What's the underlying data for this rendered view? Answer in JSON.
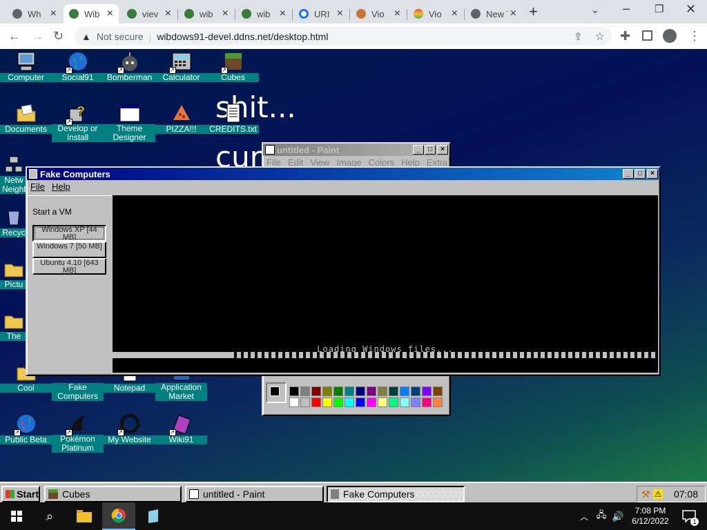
{
  "browser": {
    "tabs": [
      {
        "label": "Wh",
        "fav": "#4285f4"
      },
      {
        "label": "Wib",
        "fav": "#3a7a3a"
      },
      {
        "label": "viev",
        "fav": "#3a7a3a"
      },
      {
        "label": "wib",
        "fav": "#3a7a3a"
      },
      {
        "label": "wib",
        "fav": "#3a7a3a"
      },
      {
        "label": "URI",
        "fav": "#1a73e8"
      },
      {
        "label": "Vio",
        "fav": "#c87533"
      },
      {
        "label": "Vio",
        "fav": "#e8a33d"
      },
      {
        "label": "New Tab",
        "fav": "#5f6368"
      }
    ],
    "security_label": "Not secure",
    "url": "wibdows91-devel.ddns.net/desktop.html"
  },
  "desktop": {
    "icons": [
      {
        "label": "Computer",
        "icon": "computer-icon"
      },
      {
        "label": "Social91",
        "icon": "globe-icon"
      },
      {
        "label": "Bomberman",
        "icon": "bomb-icon"
      },
      {
        "label": "Calculator",
        "icon": "calculator-icon"
      },
      {
        "label": "Cubes",
        "icon": "cube-icon"
      },
      {
        "label": "Documents",
        "icon": "folder-doc-icon"
      },
      {
        "label": "Develop or Install",
        "icon": "help-icon"
      },
      {
        "label": "Theme Designer",
        "icon": "window-icon"
      },
      {
        "label": "PIZZA!!!",
        "icon": "pizza-icon"
      },
      {
        "label": "CREDITS.txt",
        "icon": "text-file-icon"
      },
      {
        "label": "Netw Neighb",
        "icon": "network-icon"
      },
      {
        "label": "Recyc",
        "icon": "recycle-icon"
      },
      {
        "label": "Pictu",
        "icon": "folder-icon"
      },
      {
        "label": "The",
        "icon": "folder-icon"
      },
      {
        "label": "Cool",
        "icon": "folder-icon"
      },
      {
        "label": "Fake Computers",
        "icon": "computer-icon"
      },
      {
        "label": "Notepad",
        "icon": "notepad-icon"
      },
      {
        "label": "Application Market",
        "icon": "market-icon"
      },
      {
        "label": "Public Beta",
        "icon": "globe-icon"
      },
      {
        "label": "Pokémon Platinum",
        "icon": "pokemon-icon"
      },
      {
        "label": "My Website",
        "icon": "circle-icon"
      },
      {
        "label": "Wiki91",
        "icon": "book-icon"
      }
    ],
    "background_text_1": "shit...",
    "background_text_2": "cur"
  },
  "paint": {
    "title": "untitled - Paint",
    "menu": [
      "File",
      "Edit",
      "View",
      "Image",
      "Colors",
      "Help",
      "Extra"
    ],
    "palette_top": [
      "#000000",
      "#808080",
      "#800000",
      "#808000",
      "#008000",
      "#008080",
      "#000080",
      "#800080",
      "#808040",
      "#004040",
      "#0080ff",
      "#004080",
      "#8000ff",
      "#804000"
    ],
    "palette_bottom": [
      "#ffffff",
      "#c0c0c0",
      "#ff0000",
      "#ffff00",
      "#00ff00",
      "#00ffff",
      "#0000ff",
      "#ff00ff",
      "#ffff80",
      "#00ff80",
      "#80ffff",
      "#8080ff",
      "#ff0080",
      "#ff8040"
    ]
  },
  "fake_computers": {
    "title": "Fake Computers",
    "menu": [
      "File",
      "Help"
    ],
    "start_label": "Start a VM",
    "vms": [
      {
        "label": "Windows XP [44 MB]"
      },
      {
        "label": "Windows 7 [50 MB]"
      },
      {
        "label": "Ubuntu 4.10 [643 MB]"
      }
    ],
    "loading_text": "Loading Windows files...",
    "progress": 0.22
  },
  "taskbar": {
    "start": "Start",
    "buttons": [
      {
        "label": "Cubes"
      },
      {
        "label": "untitled - Paint"
      },
      {
        "label": "Fake Computers"
      }
    ],
    "clock": "07:08"
  },
  "system": {
    "time": "7:08 PM",
    "date": "6/12/2022",
    "notifications": "1"
  }
}
